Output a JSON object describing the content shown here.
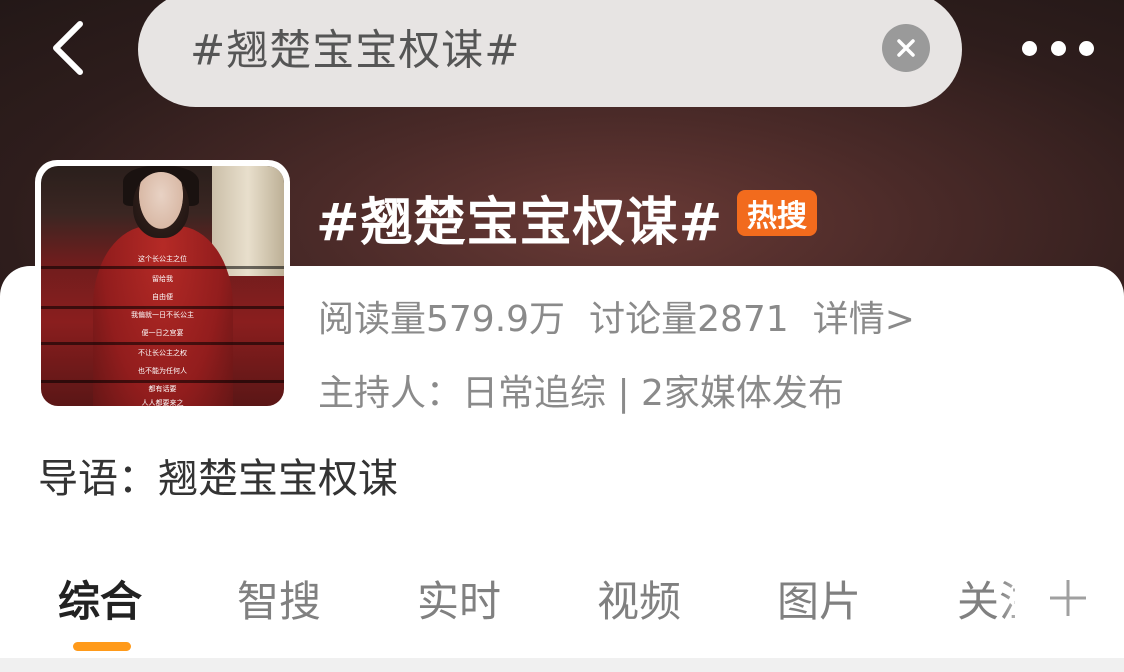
{
  "search": {
    "query": "#翘楚宝宝权谋#"
  },
  "topic": {
    "title": "#翘楚宝宝权谋#",
    "badge": "热搜",
    "reads": "阅读量579.9万",
    "discussions": "讨论量2871",
    "details_link": "详情>",
    "host_line": "主持人：日常追综 | 2家媒体发布",
    "guide": "导语：翘楚宝宝权谋"
  },
  "thumbnail": {
    "subtitles": [
      "这个长公主之位",
      "留给我",
      "自由便",
      "我偏就一日不长公主",
      "便一日之宫宴",
      "不让长公主之权",
      "也不能为任何人",
      "都有话要",
      "人人都要来之"
    ]
  },
  "tabs": [
    {
      "label": "综合",
      "active": true
    },
    {
      "label": "智搜",
      "active": false
    },
    {
      "label": "实时",
      "active": false
    },
    {
      "label": "视频",
      "active": false
    },
    {
      "label": "图片",
      "active": false
    },
    {
      "label": "关注",
      "active": false
    }
  ],
  "colors": {
    "accent_orange": "#ff9a1a",
    "hot_badge": "#f26b1d"
  },
  "icons": {
    "back": "back-arrow-icon",
    "clear": "clear-icon",
    "more": "more-icon",
    "add_tab": "plus-icon"
  }
}
